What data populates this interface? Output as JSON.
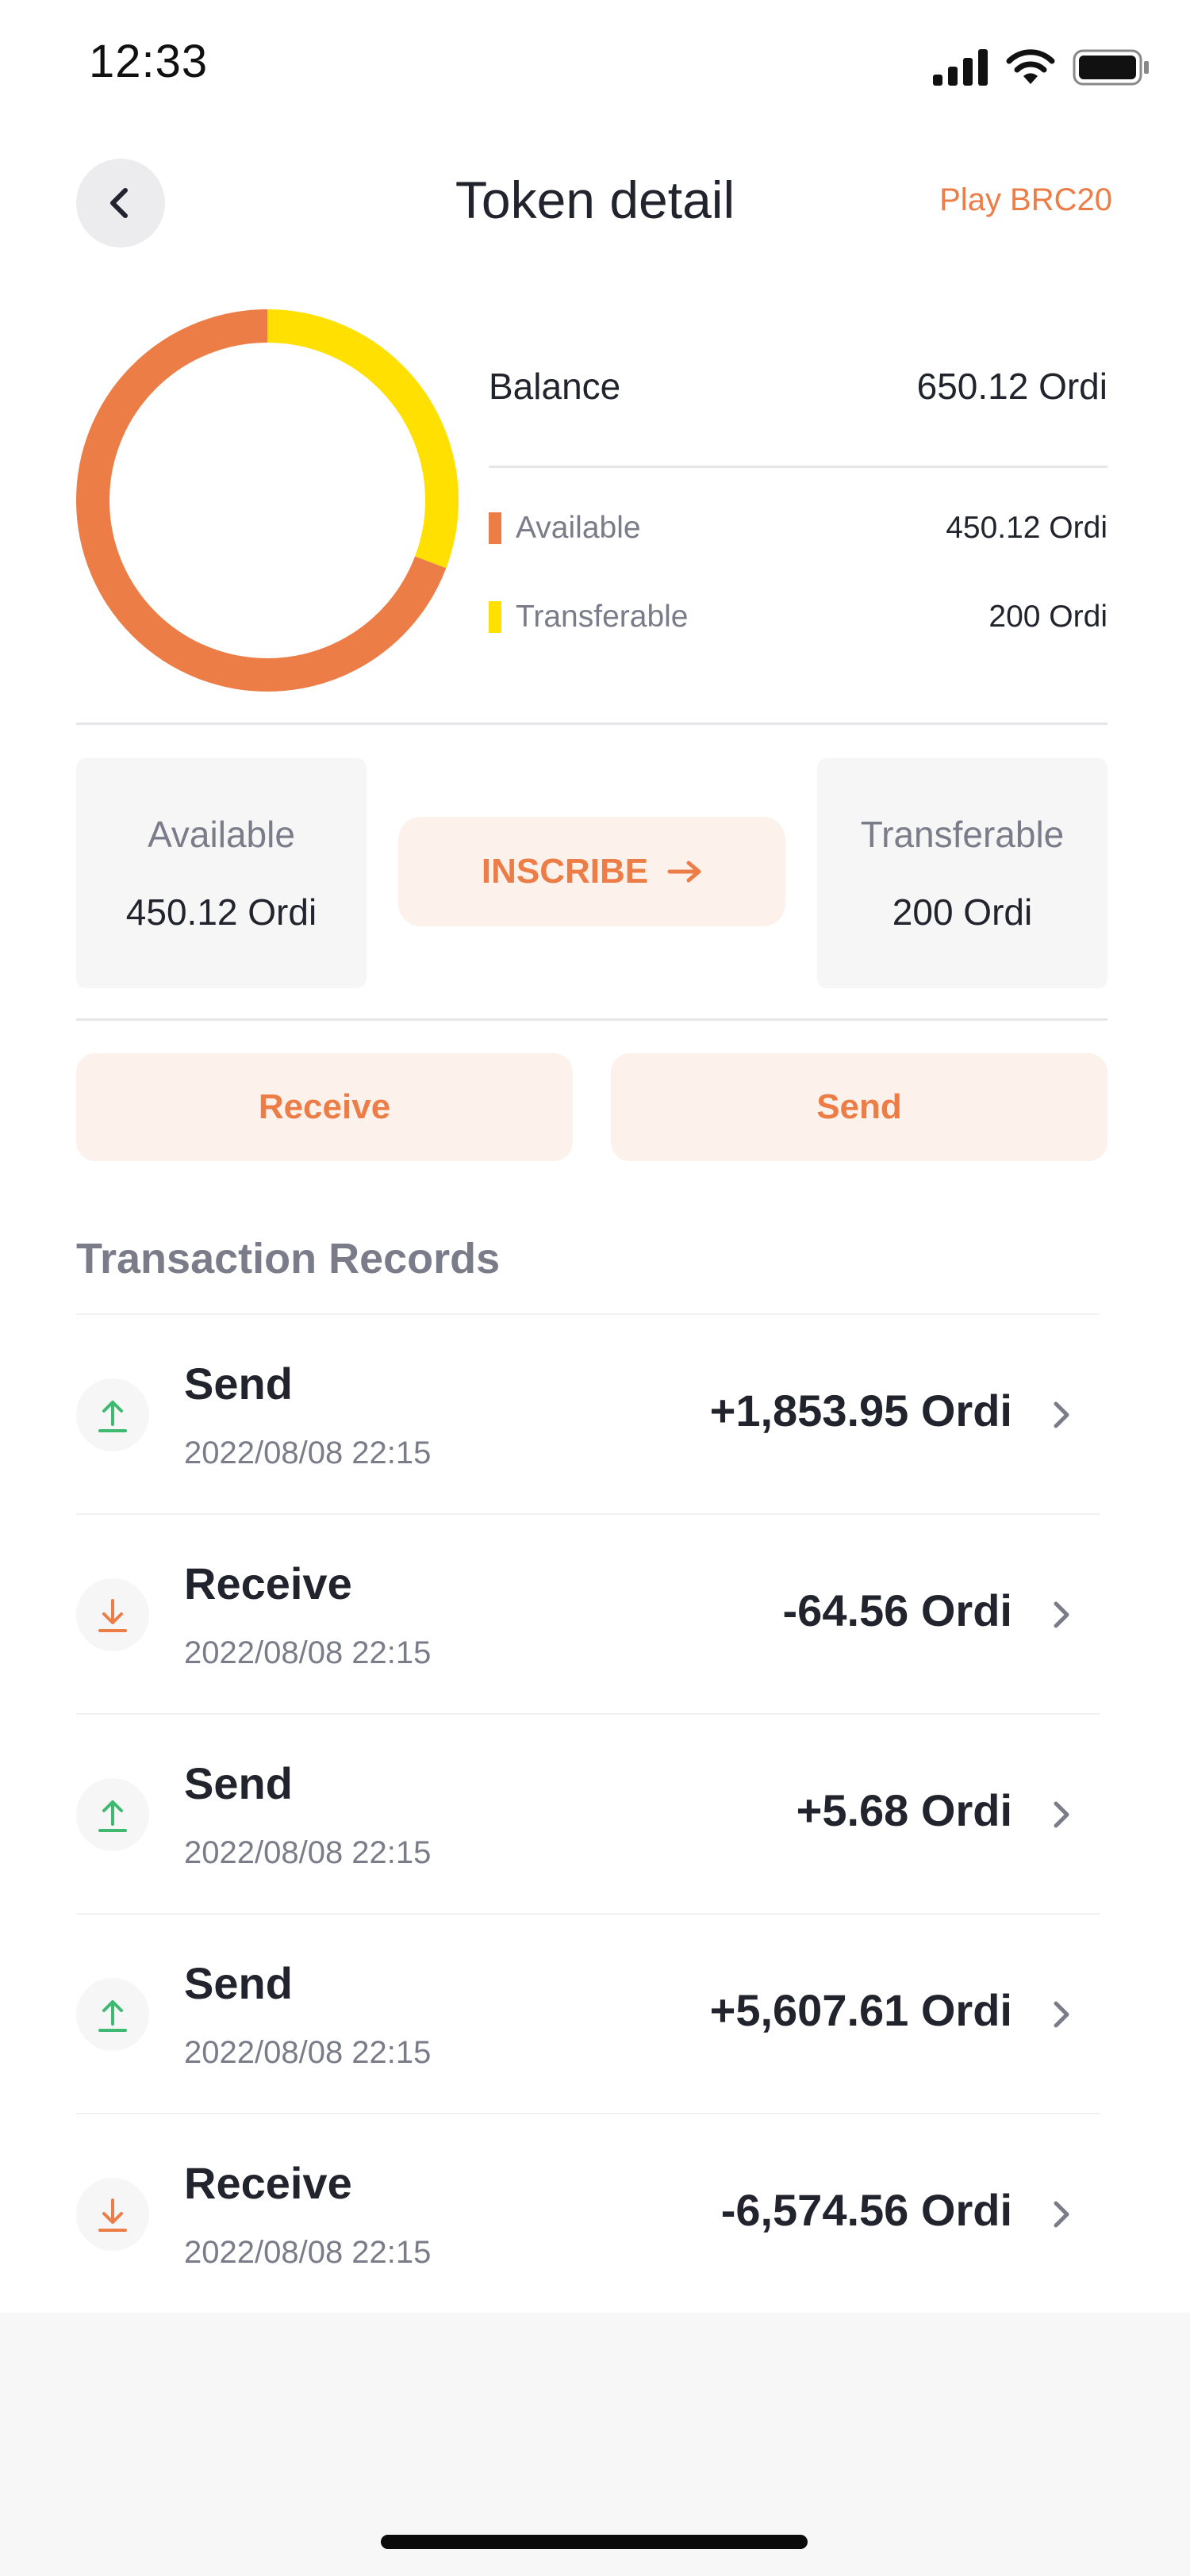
{
  "status_bar": {
    "time": "12:33"
  },
  "header": {
    "title": "Token detail",
    "action_label": "Play BRC20"
  },
  "balance": {
    "label": "Balance",
    "value": "650.12 Ordi",
    "legend": [
      {
        "label": "Available",
        "value": "450.12 Ordi",
        "color": "#ed7d47"
      },
      {
        "label": "Transferable",
        "value": "200 Ordi",
        "color": "#ffe000"
      }
    ],
    "available_fraction": 0.6924,
    "transferable_fraction": 0.3076
  },
  "cards": {
    "available": {
      "label": "Available",
      "value": "450.12 Ordi"
    },
    "transferable": {
      "label": "Transferable",
      "value": "200 Ordi"
    },
    "inscribe_label": "INSCRIBE"
  },
  "actions": {
    "receive_label": "Receive",
    "send_label": "Send"
  },
  "transactions": {
    "title": "Transaction Records",
    "items": [
      {
        "type": "Send",
        "date": "2022/08/08 22:15",
        "amount": "+1,853.95 Ordi",
        "icon": "upload-icon"
      },
      {
        "type": "Receive",
        "date": "2022/08/08 22:15",
        "amount": "-64.56 Ordi",
        "icon": "download-icon"
      },
      {
        "type": "Send",
        "date": "2022/08/08 22:15",
        "amount": "+5.68 Ordi",
        "icon": "upload-icon"
      },
      {
        "type": "Send",
        "date": "2022/08/08 22:15",
        "amount": "+5,607.61 Ordi",
        "icon": "upload-icon"
      },
      {
        "type": "Receive",
        "date": "2022/08/08 22:15",
        "amount": "-6,574.56 Ordi",
        "icon": "download-icon"
      }
    ]
  },
  "colors": {
    "accent": "#ed7d47",
    "transferable": "#ffe000",
    "send_icon": "#3dba6f",
    "receive_icon": "#ed7d47",
    "accent_bg": "#fdf1ec"
  }
}
